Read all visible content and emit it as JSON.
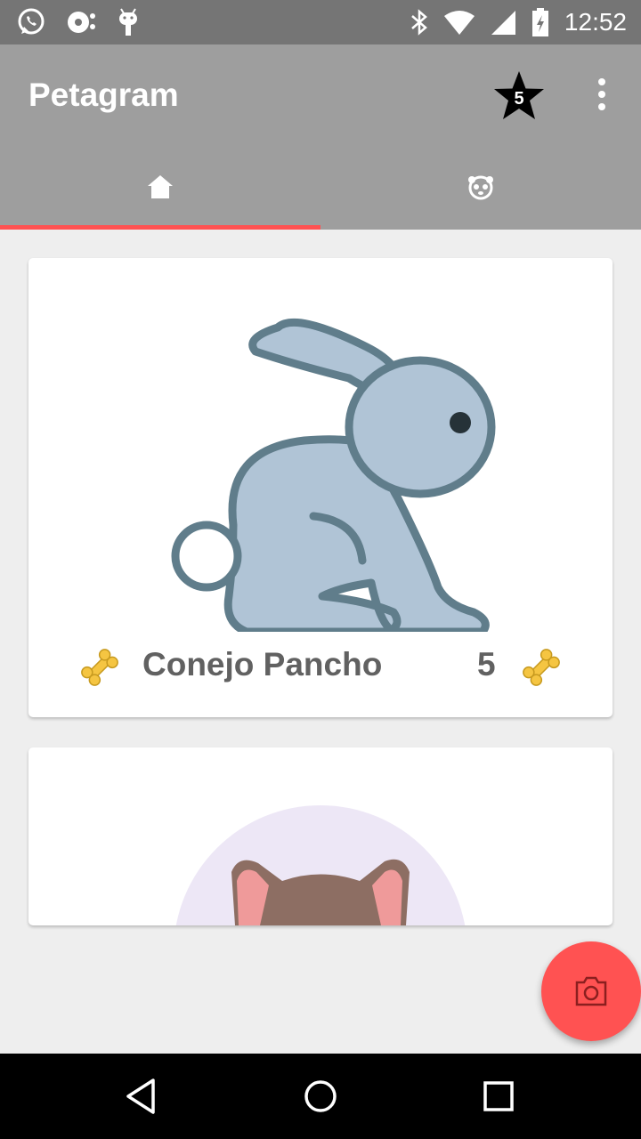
{
  "status_bar": {
    "time": "12:52",
    "left_icons": [
      "whatsapp-icon",
      "music-icon",
      "android-icon"
    ],
    "right_icons": [
      "bluetooth-icon",
      "wifi-icon",
      "signal-icon",
      "battery-charging-icon"
    ]
  },
  "app_bar": {
    "title": "Petagram",
    "favorites_count": "5",
    "favorites_icon": "star-icon",
    "overflow_icon": "more-vert-icon"
  },
  "tabs": [
    {
      "icon": "home-icon",
      "selected": true
    },
    {
      "icon": "pet-profile-icon",
      "selected": false
    }
  ],
  "pets": [
    {
      "name": "Conejo Pancho",
      "likes": "5",
      "image": "rabbit"
    },
    {
      "name": "",
      "likes": "",
      "image": "cat"
    }
  ],
  "fab": {
    "icon": "camera-icon"
  },
  "nav_bar": {
    "icons": [
      "back-icon",
      "home-icon",
      "recents-icon"
    ]
  },
  "colors": {
    "app_bar": "#9e9e9e",
    "status_bar": "#757575",
    "accent": "#ff5252",
    "background": "#eeeeee",
    "text_secondary": "#616161",
    "bone": "#f5c542"
  }
}
